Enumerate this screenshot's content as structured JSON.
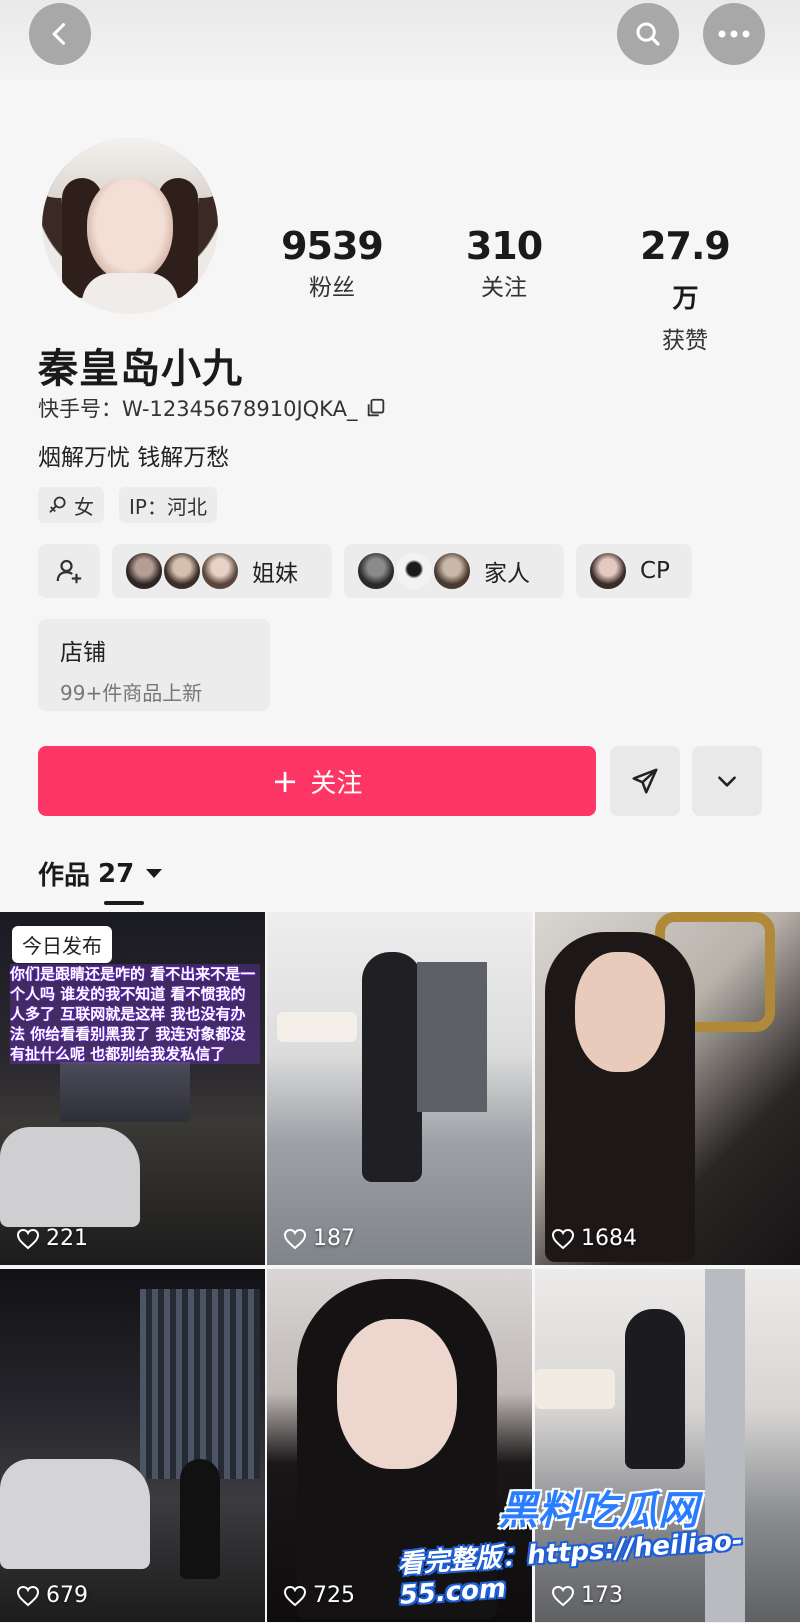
{
  "profile": {
    "name": "秦皇岛小九",
    "uid": "快手号：W-12345678910JQKA_",
    "bio": "烟解万忧 钱解万愁",
    "gender_tag": "女",
    "ip_tag": "IP：河北"
  },
  "stats": {
    "fans_value": "9539",
    "fans_label": "粉丝",
    "following_value": "310",
    "following_label": "关注",
    "likes_value": "27.9",
    "likes_unit": "万",
    "likes_label": "获赞"
  },
  "relations": {
    "sisters_label": "姐妹",
    "family_label": "家人",
    "cp_label": "CP"
  },
  "shop": {
    "title": "店铺",
    "subtitle": "99+件商品上新"
  },
  "actions": {
    "follow_label": "关注",
    "follow_plus": "+"
  },
  "works": {
    "tab_label": "作品",
    "count": "27",
    "today_badge": "今日发布",
    "overlay_text": "你们是跟睛还是咋的 看不出来不是一个人吗 谁发的我不知道 看不惯我的人多了 互联网就是这样 我也没有办法 你给看看别黑我了 我连对象都没有扯什么呢 也都别给我发私信了",
    "items": [
      {
        "likes": "221"
      },
      {
        "likes": "187"
      },
      {
        "likes": "1684"
      },
      {
        "likes": "679"
      },
      {
        "likes": "725"
      },
      {
        "likes": "173"
      }
    ]
  },
  "watermark": {
    "brand": "黑料吃瓜网",
    "url": "看完整版：https://heiliao-55.com"
  },
  "colors": {
    "accent": "#fe3666",
    "background": "#f6f6f6",
    "chip_bg": "#ececec"
  }
}
